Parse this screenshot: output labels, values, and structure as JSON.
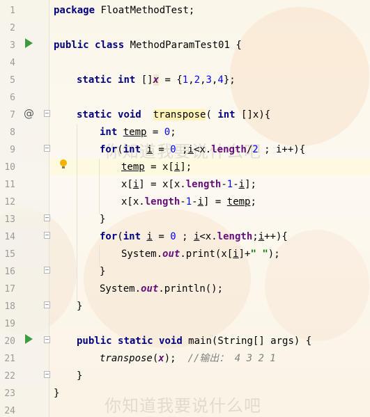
{
  "editor": {
    "line_numbers": [
      "1",
      "2",
      "3",
      "4",
      "5",
      "6",
      "7",
      "8",
      "9",
      "10",
      "11",
      "12",
      "13",
      "14",
      "15",
      "16",
      "17",
      "18",
      "19",
      "20",
      "21",
      "22",
      "23",
      "24"
    ],
    "gutter_icons": {
      "run_class": "run-icon",
      "run_main": "run-icon",
      "override": "@",
      "bulb": "bulb-icon"
    },
    "watermark": {
      "text": "你知道我要说什么吧"
    },
    "code": {
      "l1_kw": "package",
      "l1_rest": " FloatMethodTest;",
      "l3_kw1": "public",
      "l3_kw2": "class",
      "l3_rest": " MethodParamTest01 {",
      "l5_kw1": "static",
      "l5_kw2": "int",
      "l5_br": " []",
      "l5_var": "x",
      "l5_eq": " = {",
      "l5_n1": "1",
      "l5_c1": ",",
      "l5_n2": "2",
      "l5_c2": ",",
      "l5_n3": "3",
      "l5_c3": ",",
      "l5_n4": "4",
      "l5_end": "};",
      "l7_kw1": "static",
      "l7_kw2": "void",
      "l7_sp": "  ",
      "l7_name": "transpose",
      "l7_p": "( ",
      "l7_kw3": "int",
      "l7_rest": " []x){",
      "l8_kw": "int",
      "l8_sp": " ",
      "l8_var": "temp",
      "l8_eq": " = ",
      "l8_num": "0",
      "l8_end": ";",
      "l9_for": "for",
      "l9_p": "(",
      "l9_int": "int",
      "l9_a": " ",
      "l9_i": "i",
      "l9_b": " = ",
      "l9_n0": "0",
      "l9_c": " ;",
      "l9_i2": "i",
      "l9_d": "<x.",
      "l9_len": "length",
      "l9_e": "/",
      "l9_n2": "2",
      "l9_f": " ; i++){",
      "l10_var": "temp",
      "l10_eq": " = x[",
      "l10_i": "i",
      "l10_end": "];",
      "l11_a": "x[",
      "l11_i": "i",
      "l11_b": "] = x[x.",
      "l11_len": "length",
      "l11_c": "-",
      "l11_n": "1",
      "l11_d": "-",
      "l11_i2": "i",
      "l11_e": "];",
      "l12_a": "x[x.",
      "l12_len": "length",
      "l12_b": "-",
      "l12_n": "1",
      "l12_c": "-",
      "l12_i": "i",
      "l12_d": "] = ",
      "l12_var": "temp",
      "l12_e": ";",
      "l13": "}",
      "l14_for": "for",
      "l14_p": "(",
      "l14_int": "int",
      "l14_a": " ",
      "l14_i": "i",
      "l14_b": " = ",
      "l14_n0": "0",
      "l14_c": " ; ",
      "l14_i2": "i",
      "l14_d": "<x.",
      "l14_len": "length",
      "l14_e": ";",
      "l14_i3": "i",
      "l14_f": "++){",
      "l15_a": "System.",
      "l15_out": "out",
      "l15_b": ".print(x[",
      "l15_i": "i",
      "l15_c": "]+",
      "l15_str": "\" \"",
      "l15_d": ");",
      "l16": "}",
      "l17_a": "System.",
      "l17_out": "out",
      "l17_b": ".println();",
      "l18": "}",
      "l20_kw1": "public",
      "l20_kw2": "static",
      "l20_kw3": "void",
      "l20_rest": " main(String[] args) {",
      "l21_call": "transpose",
      "l21_a": "(",
      "l21_x": "x",
      "l21_b": ");  ",
      "l21_cm": "//输出： 4 3 2 1",
      "l22": "}",
      "l23": "}"
    }
  }
}
